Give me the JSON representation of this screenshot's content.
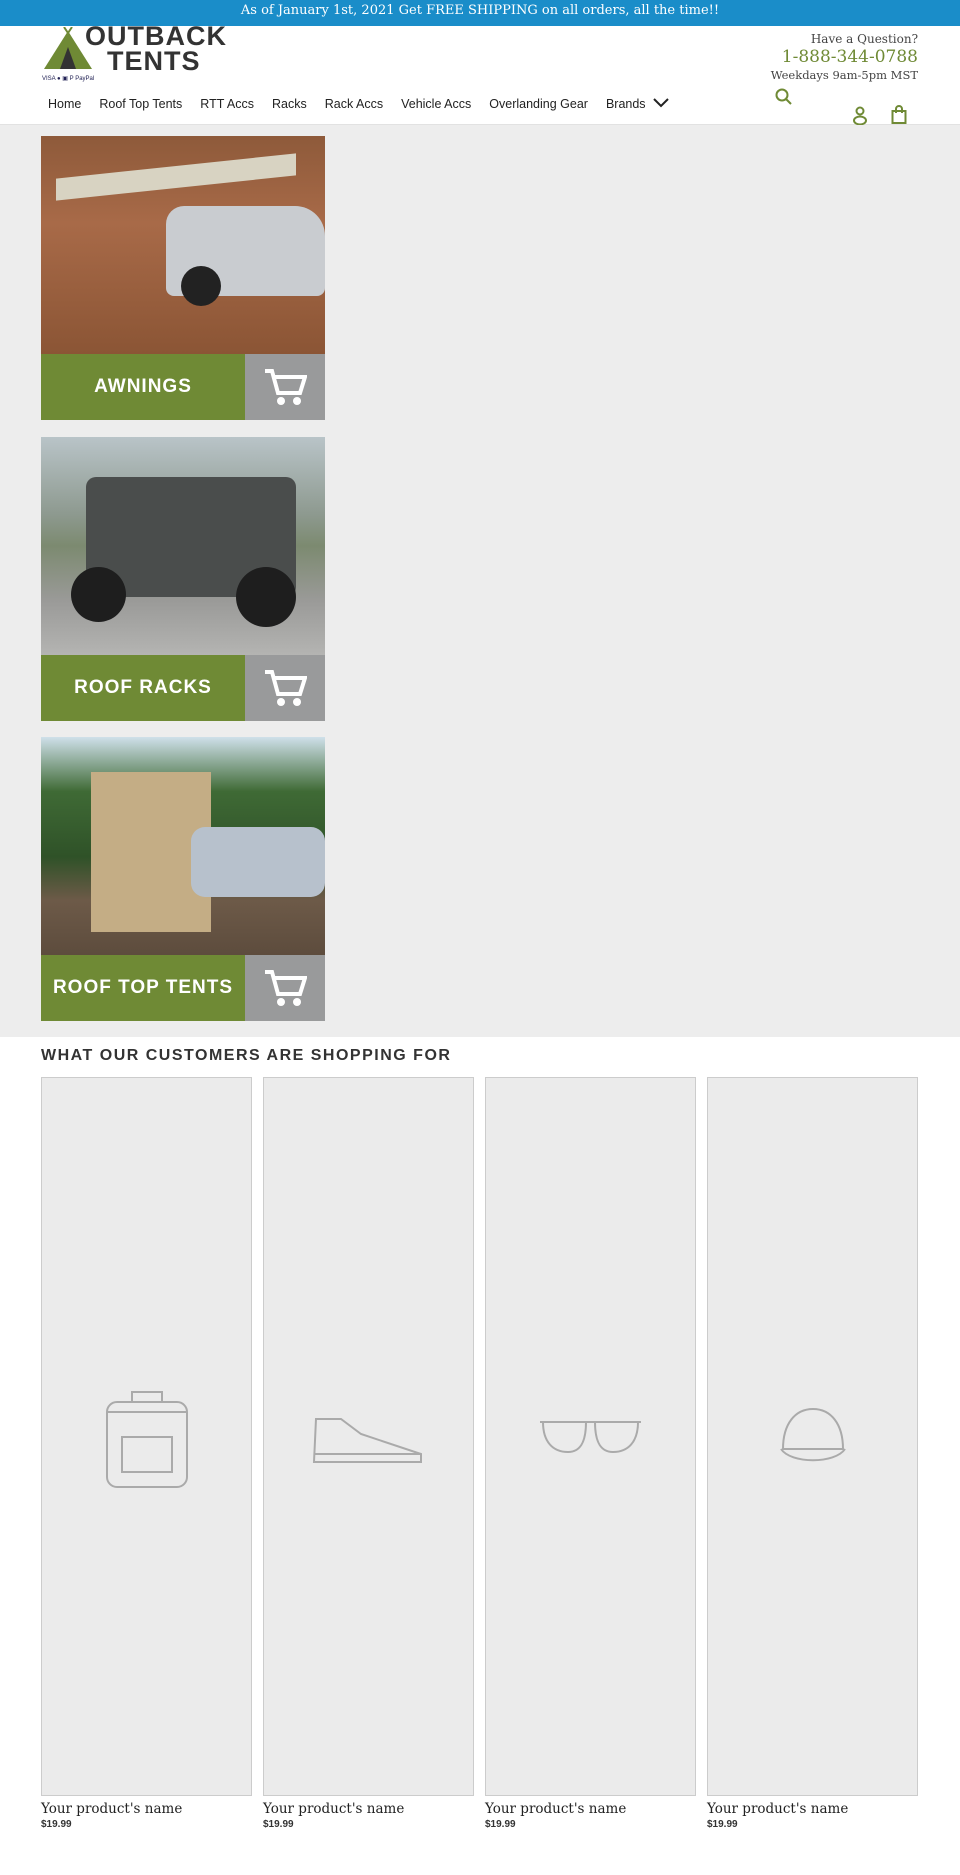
{
  "banner": {
    "text": "As of January 1st, 2021 Get FREE SHIPPING on all orders, all the time!!"
  },
  "logo": {
    "line1": "OUTBACK",
    "line2": "TENTS",
    "payments": "VISA ● ▣ P PayPal"
  },
  "contact": {
    "question": "Have a Question?",
    "phone": "1-888-344-0788",
    "hours": "Weekdays 9am-5pm MST"
  },
  "nav": {
    "items": [
      "Home",
      "Roof Top Tents",
      "RTT Accs",
      "Racks",
      "Rack Accs",
      "Vehicle Accs",
      "Overlanding Gear",
      "Brands"
    ]
  },
  "colors": {
    "brand_green": "#6f8a35",
    "banner_blue": "#1a8dc9"
  },
  "tiles": [
    {
      "label": "AWNINGS"
    },
    {
      "label": "ROOF RACKS"
    },
    {
      "label": "ROOF TOP TENTS"
    }
  ],
  "products": {
    "heading": "WHAT OUR CUSTOMERS ARE SHOPPING FOR",
    "items": [
      {
        "name": "Your product's name",
        "price": "$19.99",
        "icon": "backpack-icon"
      },
      {
        "name": "Your product's name",
        "price": "$19.99",
        "icon": "shoe-icon"
      },
      {
        "name": "Your product's name",
        "price": "$19.99",
        "icon": "sunglasses-icon"
      },
      {
        "name": "Your product's name",
        "price": "$19.99",
        "icon": "cap-icon"
      }
    ]
  }
}
